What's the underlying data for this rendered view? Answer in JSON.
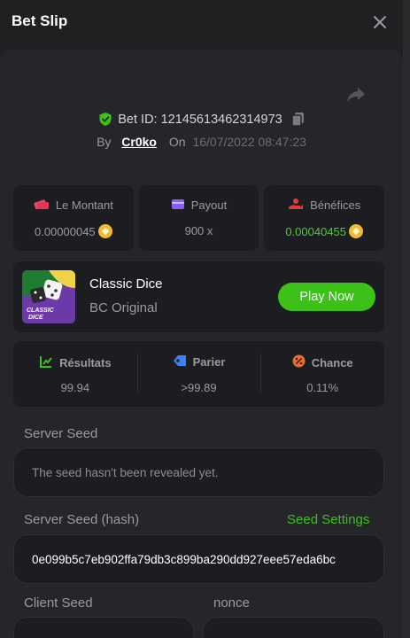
{
  "header": {
    "title": "Bet Slip",
    "close_icon": "close-icon"
  },
  "bet": {
    "id_label": "Bet ID: 12145613462314973",
    "by_label": "By",
    "user": "Cr0ko",
    "on_label": "On",
    "date": "16/07/2022 08:47:23"
  },
  "stats": [
    {
      "label": "Le Montant",
      "value": "0.00000045",
      "icon": "money-stack-icon",
      "color": "#f2486b"
    },
    {
      "label": "Payout",
      "value": "900 x",
      "icon": "wallet-icon",
      "color": "#8b5cf6"
    },
    {
      "label": "Bénéfices",
      "value": "0.00040455",
      "icon": "profit-hand-icon",
      "color": "#e23b3b"
    }
  ],
  "game": {
    "name": "Classic Dice",
    "provider": "BC Original",
    "play_label": "Play Now",
    "thumb_text_1": "CLASSIC",
    "thumb_text_2": "DICE"
  },
  "results": [
    {
      "label": "Résultats",
      "value": "99.94",
      "icon": "result-chart-icon",
      "color": "#3bc117"
    },
    {
      "label": "Parier",
      "value": ">99.89",
      "icon": "tag-icon",
      "color": "#3b82f6"
    },
    {
      "label": "Chance",
      "value": "0.11%",
      "icon": "percent-icon",
      "color": "#f06a25"
    }
  ],
  "seeds": {
    "server_label": "Server Seed",
    "server_value": "The seed hasn't been revealed yet.",
    "hash_label": "Server Seed (hash)",
    "settings_link": "Seed Settings",
    "hash_value": "0e099b5c7eb902ffa79db3c899ba290dd927eee57eda6bc",
    "client_label": "Client Seed",
    "nonce_label": "nonce"
  },
  "colors": {
    "accent": "#3bc117",
    "background": "#1f2022",
    "card": "#1c1d20"
  }
}
